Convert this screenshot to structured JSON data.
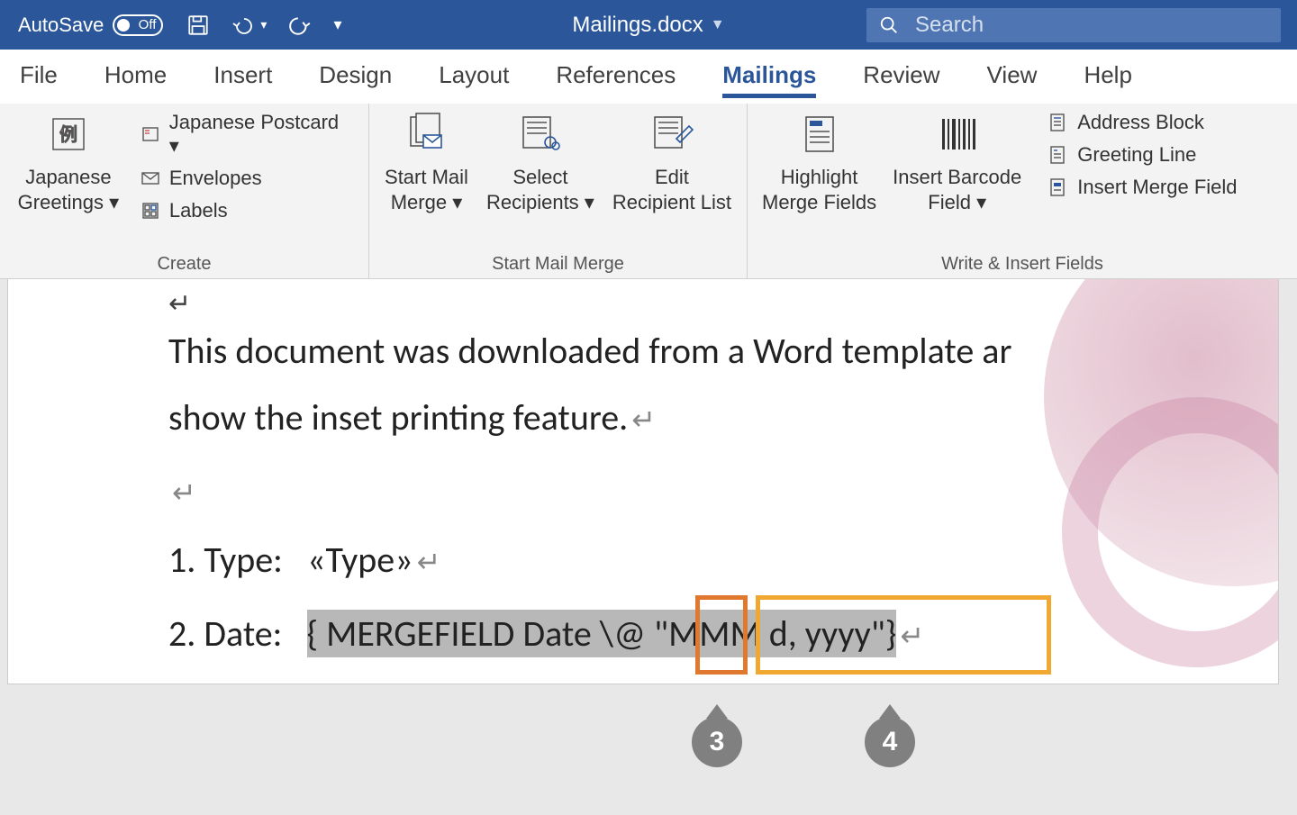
{
  "titlebar": {
    "autosave_label": "AutoSave",
    "toggle_state": "Off",
    "doc_name": "Mailings.docx",
    "search_placeholder": "Search"
  },
  "tabs": [
    "File",
    "Home",
    "Insert",
    "Design",
    "Layout",
    "References",
    "Mailings",
    "Review",
    "View",
    "Help"
  ],
  "active_tab": "Mailings",
  "ribbon": {
    "group_create": {
      "title": "Create",
      "japanese_greetings": "Japanese Greetings",
      "japanese_postcard": "Japanese Postcard",
      "envelopes": "Envelopes",
      "labels": "Labels"
    },
    "group_start": {
      "title": "Start Mail Merge",
      "start_mail_merge": "Start Mail Merge",
      "select_recipients": "Select Recipients",
      "edit_recipient_list": "Edit Recipient List"
    },
    "group_write": {
      "title": "Write & Insert Fields",
      "highlight_merge_fields": "Highlight Merge Fields",
      "insert_barcode_field": "Insert Barcode Field",
      "address_block": "Address Block",
      "greeting_line": "Greeting Line",
      "insert_merge_field": "Insert Merge Field"
    }
  },
  "document": {
    "para1_line1": "This document was downloaded from a Word template ar",
    "para1_line2": "show the inset printing feature.",
    "line_type_label": "1. Type:",
    "line_type_field": "«Type»",
    "line_date_label": "2. Date:",
    "merge_prefix": "{ MERGEFIELD Date ",
    "merge_switch": "\\@",
    "merge_space": " ",
    "merge_format": "\"MMM d, yyyy\"}"
  },
  "callouts": {
    "c3": "3",
    "c4": "4"
  }
}
